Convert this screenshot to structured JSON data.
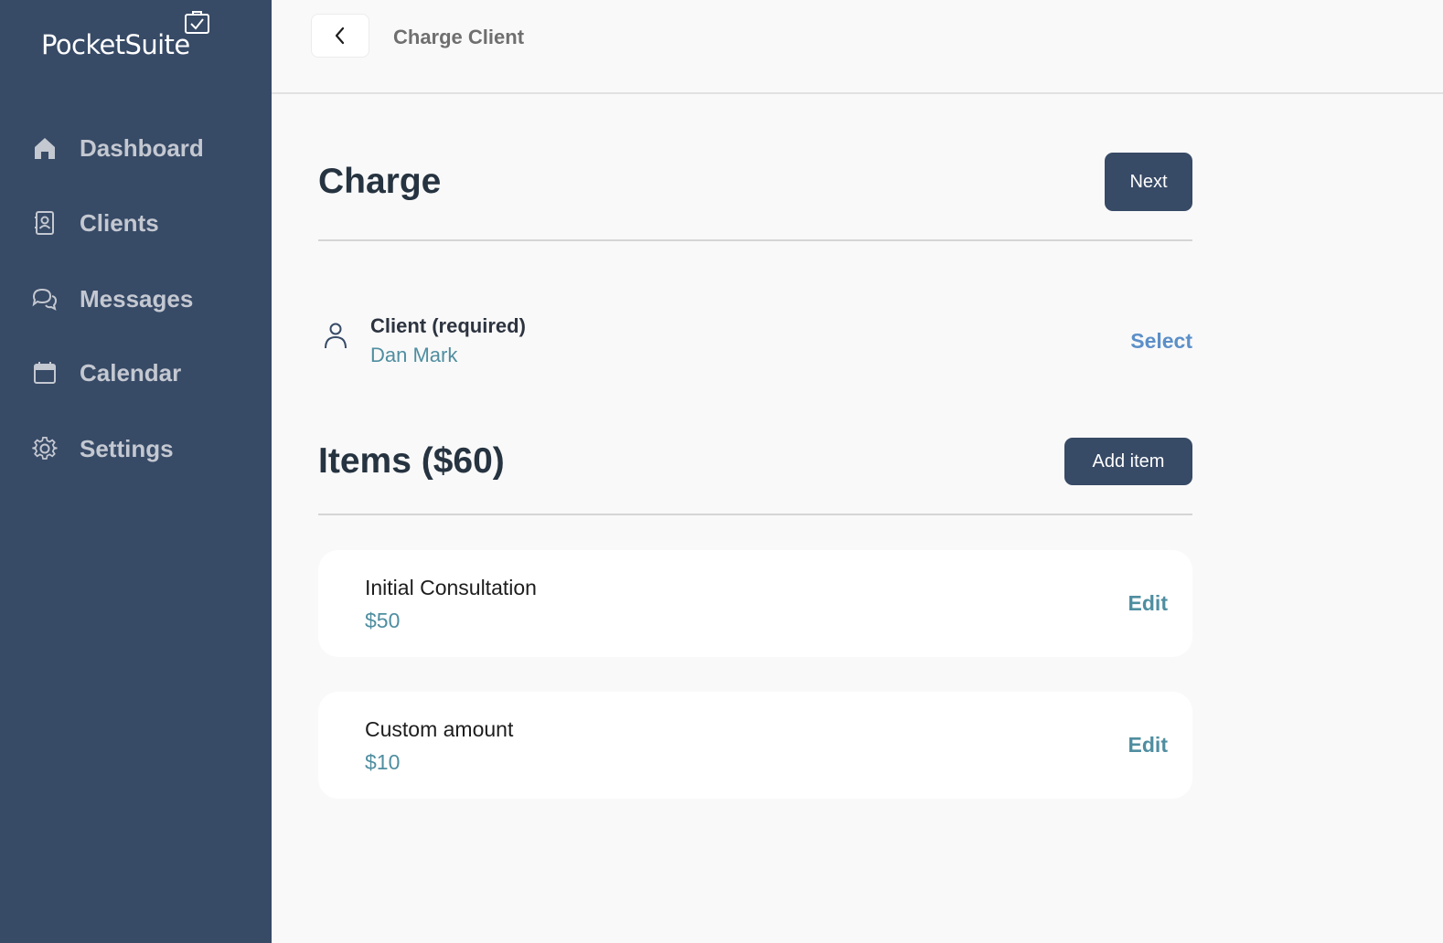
{
  "app": {
    "name": "PocketSuite"
  },
  "sidebar": {
    "items": [
      {
        "label": "Dashboard",
        "icon": "home-icon"
      },
      {
        "label": "Clients",
        "icon": "contact-book-icon"
      },
      {
        "label": "Messages",
        "icon": "chat-bubbles-icon"
      },
      {
        "label": "Calendar",
        "icon": "calendar-icon"
      },
      {
        "label": "Settings",
        "icon": "gear-icon"
      }
    ]
  },
  "topbar": {
    "title": "Charge Client",
    "back_icon": "chevron-left-icon"
  },
  "charge": {
    "title": "Charge",
    "next_label": "Next"
  },
  "client": {
    "label": "Client (required)",
    "value": "Dan Mark",
    "action": "Select",
    "icon": "person-icon"
  },
  "items_section": {
    "title": "Items ($60)",
    "add_label": "Add item"
  },
  "items": [
    {
      "name": "Initial Consultation",
      "price": "$50",
      "action": "Edit"
    },
    {
      "name": "Custom amount",
      "price": "$10",
      "action": "Edit"
    }
  ],
  "colors": {
    "sidebar": "#374a66",
    "accent": "#4f8ea0",
    "link": "#5b8fc8",
    "button": "#374a66"
  }
}
